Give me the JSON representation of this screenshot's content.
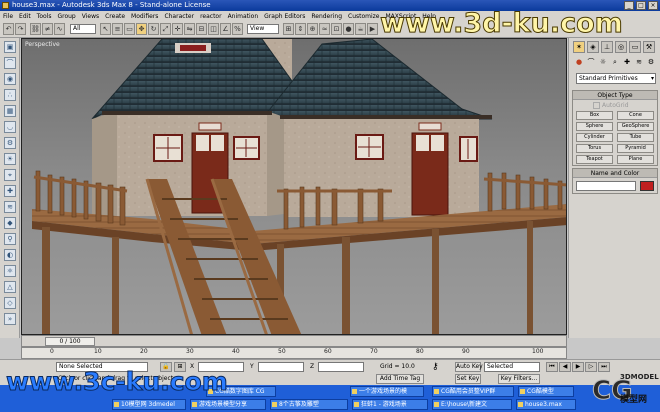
{
  "window": {
    "title": "house3.max - Autodesk 3ds Max 8 - Stand-alone License",
    "controls": [
      "_",
      "□",
      "×"
    ]
  },
  "menu": [
    "File",
    "Edit",
    "Tools",
    "Group",
    "Views",
    "Create",
    "Modifiers",
    "Character",
    "reactor",
    "Animation",
    "Graph Editors",
    "Rendering",
    "Customize",
    "MAXScript",
    "Help"
  ],
  "watermark_top": "www.3d-ku.com",
  "toolbar": {
    "selection_filter": "All",
    "reference_coord": "View"
  },
  "viewport": {
    "label": "Perspective"
  },
  "command_panel": {
    "dropdown": "Standard Primitives",
    "object_type": {
      "header": "Object Type",
      "autogrid": "AutoGrid",
      "buttons": [
        "Box",
        "Cone",
        "Sphere",
        "GeoSphere",
        "Cylinder",
        "Tube",
        "Torus",
        "Pyramid",
        "Teapot",
        "Plane"
      ]
    },
    "name_color": {
      "header": "Name and Color"
    }
  },
  "time": {
    "slider": "0 / 100",
    "ticks": [
      "0",
      "10",
      "20",
      "30",
      "40",
      "50",
      "60",
      "70",
      "80",
      "90",
      "100"
    ]
  },
  "status": {
    "selection": "None Selected",
    "prompt": "Click or click-and-drag to select objects",
    "x_label": "X",
    "y_label": "Y",
    "z_label": "Z",
    "grid": "Grid = 10.0",
    "add_time_tag": "Add Time Tag",
    "auto_key": "Auto Key",
    "set_key": "Set Key",
    "key_mode": "Selected",
    "key_filters": "Key Filters..."
  },
  "watermark_bottom": "www.3c-ku.com",
  "taskbar": {
    "top_row": [
      "CG酷数字图库 CG",
      "一个游戏场景的模",
      "CG酷用会员整VIP群",
      "CG酷模型"
    ],
    "bottom_row": [
      "10模型网 3dmedel",
      "游戏场景模型分享",
      "8个古筝及雕塑",
      "狂蚌1 - 游戏场景",
      "E:\\house\\新建文",
      "house3.max"
    ]
  },
  "logo": {
    "big": "CG",
    "top": "3DMODEL",
    "bottom": "模型网"
  }
}
